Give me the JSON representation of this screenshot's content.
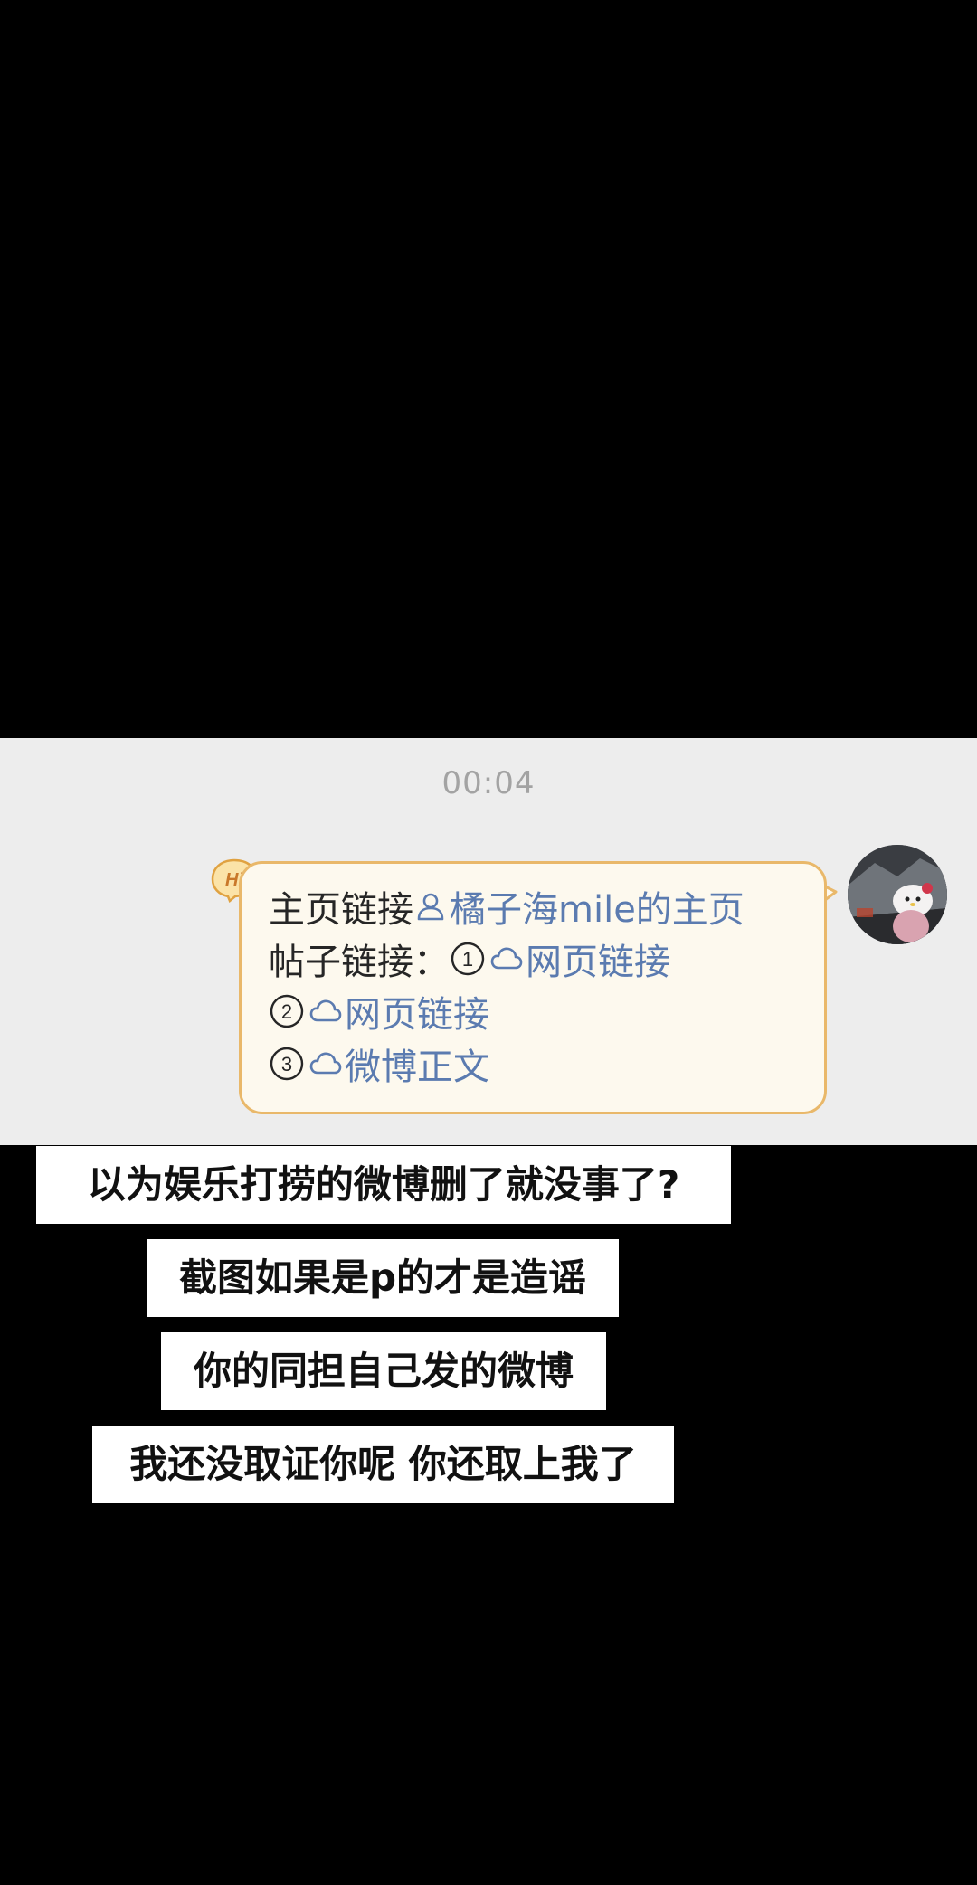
{
  "chat": {
    "timestamp": "00:04",
    "badge": "Hi",
    "message": {
      "line1_prefix": "主页链接",
      "line1_link": "橘子海mile的主页",
      "line2_prefix": "帖子链接：",
      "circled_1": "①",
      "circled_2": "②",
      "circled_3": "③",
      "link_1": "网页链接",
      "link_2": "网页链接",
      "link_3": "微博正文"
    },
    "colors": {
      "bubble_bg": "#fdf9ee",
      "bubble_border": "#e9b86a",
      "link": "#5b7bb0",
      "panel_bg": "#ededed"
    }
  },
  "captions": [
    "以为娱乐打捞的微博删了就没事了?",
    "截图如果是p的才是造谣",
    "你的同担自己发的微博",
    "我还没取证你呢 你还取上我了"
  ],
  "icons": {
    "profile": "person-icon",
    "cloud": "cloud-icon",
    "avatar": "avatar-image"
  }
}
